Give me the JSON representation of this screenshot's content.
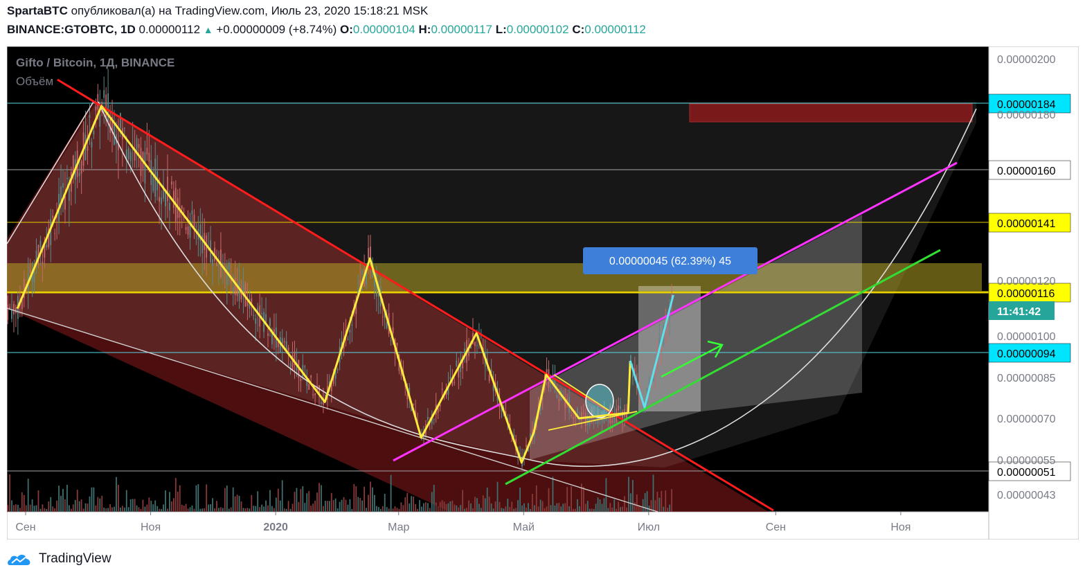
{
  "header": {
    "author": "SpartaBTC",
    "published_text": " опубликовал(а) на TradingView.com, Июль 23, 2020 15:18:21 MSK",
    "symbol": "BINANCE:GTOBTC, 1D",
    "last": "0.00000112",
    "change": "+0.00000009 (+8.74%)",
    "o_label": "O:",
    "o": "0.00000104",
    "h_label": "H:",
    "h": "0.00000117",
    "l_label": "L:",
    "l": "0.00000102",
    "c_label": "C:",
    "c": "0.00000112"
  },
  "legend": {
    "title": "Gifto / Bitcoin, 1Д, BINANCE",
    "volume": "Объём"
  },
  "footer": {
    "brand": "TradingView"
  },
  "colors": {
    "bg": "#000000",
    "axis_bg": "#ffffff",
    "red_channel": "#8b1a1a",
    "red_line": "#ff1c1c",
    "yellow_zigzag": "#ffeb3b",
    "magenta": "#ff33ff",
    "green": "#33dd33",
    "cyan": "#5ee0ee",
    "blue_label": "#3d7fd9"
  },
  "chart_data": {
    "type": "candlestick",
    "x_ticks": [
      "Сен",
      "Ноя",
      "2020",
      "Мар",
      "Май",
      "Июл",
      "Сен",
      "Ноя"
    ],
    "y_ticks": [
      "0.00000200",
      "0.00000180",
      "0.00000120",
      "0.00000100",
      "0.00000085",
      "0.00000070",
      "0.00000055",
      "0.00000043"
    ],
    "y_range": [
      3.5e-07,
      2.05e-06
    ],
    "price_levels": [
      {
        "label": "0.00000184",
        "value": 1.84e-06,
        "style": "cyan"
      },
      {
        "label": "0.00000160",
        "value": 1.6e-06,
        "style": "white"
      },
      {
        "label": "0.00000141",
        "value": 1.41e-06,
        "style": "yellow"
      },
      {
        "label": "0.00000116",
        "value": 1.16e-06,
        "style": "yellow"
      },
      {
        "label": "0.00000094",
        "value": 9.4e-07,
        "style": "cyan"
      },
      {
        "label": "0.00000051",
        "value": 5.1e-07,
        "style": "white"
      }
    ],
    "countdown": "11:41:42",
    "measure_label": "0.00000045 (62.39%) 45",
    "zigzag": [
      [
        "2019-08-28",
        1.1e-06
      ],
      [
        "2019-10-08",
        1.83e-06
      ],
      [
        "2020-01-25",
        7.6e-07
      ],
      [
        "2020-02-16",
        1.28e-06
      ],
      [
        "2020-03-12",
        6.3e-07
      ],
      [
        "2020-04-08",
        1.01e-06
      ],
      [
        "2020-04-30",
        5.4e-07
      ],
      [
        "2020-05-06",
        6.5e-07
      ],
      [
        "2020-05-12",
        8.6e-07
      ],
      [
        "2020-05-28",
        7e-07
      ],
      [
        "2020-06-21",
        7.2e-07
      ],
      [
        "2020-06-22",
        9.1e-07
      ]
    ],
    "cyan_wave": [
      [
        "2020-06-22",
        9.1e-07
      ],
      [
        "2020-06-29",
        7.4e-07
      ],
      [
        "2020-07-13",
        1.15e-06
      ]
    ]
  }
}
